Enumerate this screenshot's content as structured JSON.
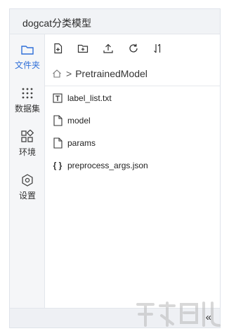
{
  "window": {
    "title": "dogcat分类模型"
  },
  "rail": [
    {
      "label": "文件夹",
      "icon": "folder-icon",
      "active": true
    },
    {
      "label": "数据集",
      "icon": "dataset-grid-icon",
      "active": false
    },
    {
      "label": "环境",
      "icon": "environment-blocks-icon",
      "active": false
    },
    {
      "label": "设置",
      "icon": "settings-gear-icon",
      "active": false
    }
  ],
  "toolbar": {
    "icons": [
      "new-file-icon",
      "new-folder-icon",
      "upload-icon",
      "refresh-icon",
      "sort-icon"
    ]
  },
  "breadcrumb": {
    "home_icon": "home-icon",
    "separator": ">",
    "current": "PretrainedModel"
  },
  "files": [
    {
      "name": "label_list.txt",
      "icon": "text-file-icon"
    },
    {
      "name": "model",
      "icon": "file-icon"
    },
    {
      "name": "params",
      "icon": "file-icon"
    },
    {
      "name": "preprocess_args.json",
      "icon": "json-file-icon"
    }
  ],
  "footer": {
    "collapse": "«"
  },
  "colors": {
    "accent": "#2f6fd8",
    "rail_bg": "#f5f6f8",
    "titlebar_bg": "#f1f3f6"
  }
}
